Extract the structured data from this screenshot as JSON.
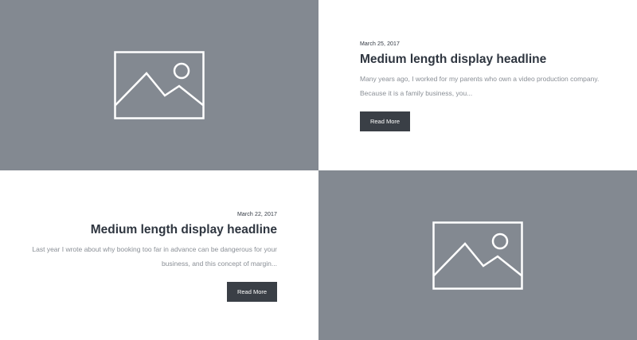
{
  "posts": [
    {
      "date": "March 25, 2017",
      "headline": "Medium length display headline",
      "excerpt": "Many years ago, I worked for my parents who own a video production company. Because it is a family business, you...",
      "button_label": "Read More",
      "image_icon": "image-placeholder-icon"
    },
    {
      "date": "March 22, 2017",
      "headline": "Medium length display headline",
      "excerpt": "Last year I wrote about why booking too far in advance can be dangerous for your business, and this concept of margin...",
      "button_label": "Read More",
      "image_icon": "image-placeholder-icon"
    }
  ],
  "colors": {
    "image_bg": "#838991",
    "headline": "#2f3640",
    "excerpt": "#8a8f96",
    "button_bg": "#3a3f46",
    "button_text": "#ffffff"
  }
}
